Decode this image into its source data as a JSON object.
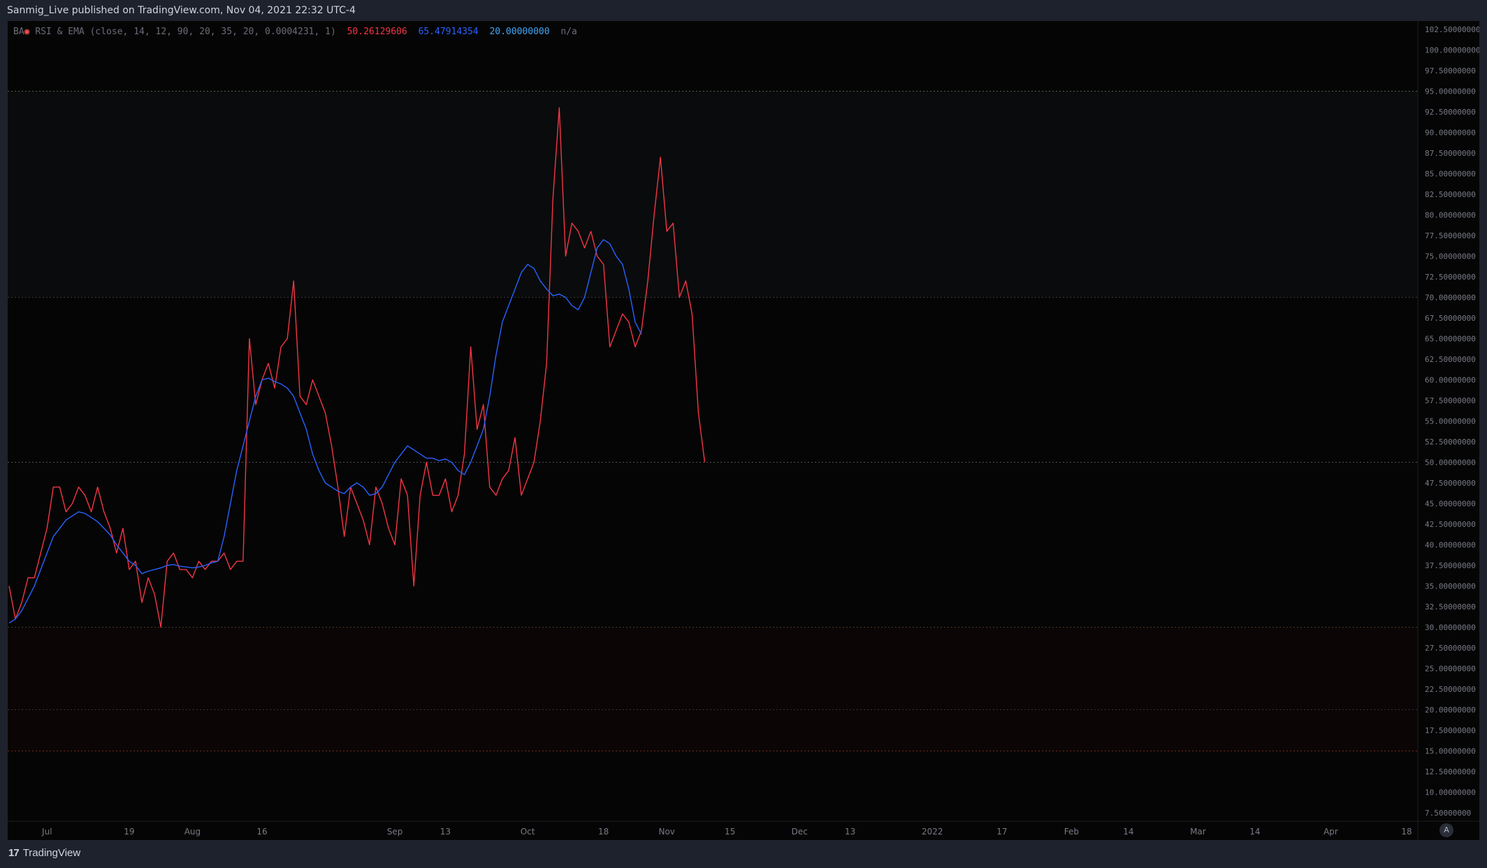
{
  "header": {
    "publish_text": "Sanmig_Live published on TradingView.com, Nov 04, 2021 22:32 UTC-4"
  },
  "legend": {
    "prefix": "BA",
    "badge_icon": "devil-face-icon",
    "study": "RSI & EMA (close, 14, 12, 90, 20, 35, 20, 0.0004231, 1)",
    "value_rsi": "50.26129606",
    "value_ema": "65.47914354",
    "value_level": "20.00000000",
    "value_na": "n/a"
  },
  "footer": {
    "brand": "TradingView",
    "auto_label": "A"
  },
  "colors": {
    "background": "#050505",
    "rsi": "#f23645",
    "ema": "#2962ff",
    "grid": "#1a1a1a",
    "axis_text": "#787b86"
  },
  "chart_data": {
    "type": "line",
    "ylim": [
      7.5,
      102.5
    ],
    "y_ticks": [
      "102.50000000",
      "100.00000000",
      "97.50000000",
      "95.00000000",
      "92.50000000",
      "90.00000000",
      "87.50000000",
      "85.00000000",
      "82.50000000",
      "80.00000000",
      "77.50000000",
      "75.00000000",
      "72.50000000",
      "70.00000000",
      "67.50000000",
      "65.00000000",
      "62.50000000",
      "60.00000000",
      "57.50000000",
      "55.00000000",
      "52.50000000",
      "50.00000000",
      "47.50000000",
      "45.00000000",
      "42.50000000",
      "40.00000000",
      "37.50000000",
      "35.00000000",
      "32.50000000",
      "30.00000000",
      "27.50000000",
      "25.00000000",
      "22.50000000",
      "20.00000000",
      "17.50000000",
      "15.00000000",
      "12.50000000",
      "10.00000000",
      "7.50000000"
    ],
    "x_ticks": [
      {
        "label": "Jul",
        "day": 6
      },
      {
        "label": "19",
        "day": 19
      },
      {
        "label": "Aug",
        "day": 29
      },
      {
        "label": "16",
        "day": 40
      },
      {
        "label": "Sep",
        "day": 61
      },
      {
        "label": "13",
        "day": 69
      },
      {
        "label": "Oct",
        "day": 82
      },
      {
        "label": "18",
        "day": 94
      },
      {
        "label": "Nov",
        "day": 104
      },
      {
        "label": "15",
        "day": 114
      },
      {
        "label": "Dec",
        "day": 125
      },
      {
        "label": "13",
        "day": 133
      },
      {
        "label": "2022",
        "day": 146
      },
      {
        "label": "17",
        "day": 157
      },
      {
        "label": "Feb",
        "day": 168
      },
      {
        "label": "14",
        "day": 177
      },
      {
        "label": "Mar",
        "day": 188
      },
      {
        "label": "14",
        "day": 197
      },
      {
        "label": "Apr",
        "day": 209
      },
      {
        "label": "18",
        "day": 221
      }
    ],
    "levels": [
      {
        "value": 95,
        "color": "#4a6a4a"
      },
      {
        "value": 70,
        "color": "#3a3a3a"
      },
      {
        "value": 50,
        "color": "#555555"
      },
      {
        "value": 30,
        "color": "#4a3a2a"
      },
      {
        "value": 20,
        "color": "#2a3a4a"
      },
      {
        "value": 15,
        "color": "#7a2a1a"
      }
    ],
    "x": [
      0,
      1,
      2,
      3,
      4,
      5,
      6,
      7,
      8,
      9,
      10,
      11,
      12,
      13,
      14,
      15,
      16,
      17,
      18,
      19,
      20,
      21,
      22,
      23,
      24,
      25,
      26,
      27,
      28,
      29,
      30,
      31,
      32,
      33,
      34,
      35,
      36,
      37,
      38,
      39,
      40,
      41,
      42,
      43,
      44,
      45,
      46,
      47,
      48,
      49,
      50,
      51,
      52,
      53,
      54,
      55,
      56,
      57,
      58,
      59,
      60,
      61,
      62,
      63,
      64,
      65,
      66,
      67,
      68,
      69,
      70,
      71,
      72,
      73,
      74,
      75,
      76,
      77,
      78,
      79,
      80,
      81,
      82,
      83,
      84,
      85,
      86,
      87,
      88,
      89,
      90,
      91,
      92,
      93,
      94,
      95,
      96,
      97,
      98,
      99,
      100,
      101,
      102,
      103,
      104,
      105,
      106
    ],
    "series": [
      {
        "values": [
          35,
          31,
          33,
          36,
          36,
          39,
          42,
          47,
          47,
          44,
          45,
          47,
          46,
          44,
          47,
          44,
          42,
          39,
          42,
          37,
          38,
          33,
          36,
          34,
          30,
          38,
          39,
          37,
          37,
          36,
          38,
          37,
          38,
          38,
          39,
          37,
          38,
          38,
          65,
          57,
          60,
          62,
          59,
          64,
          65,
          72,
          58,
          57,
          60,
          58,
          56,
          52,
          47,
          41,
          47,
          45,
          43,
          40,
          47,
          45,
          42,
          40,
          48,
          46,
          35,
          46,
          50,
          46,
          46,
          48,
          44,
          46,
          51,
          64,
          54,
          57,
          47,
          46,
          48,
          49,
          53,
          46,
          48,
          50,
          55,
          62,
          82,
          93,
          75,
          79,
          78,
          76,
          78,
          75,
          74,
          64,
          66,
          68,
          67,
          64,
          66,
          72,
          80,
          87,
          78,
          79,
          70,
          72,
          68,
          56,
          50
        ],
        "color": "#f23645"
      },
      {
        "values": [
          30.5,
          31,
          32,
          33.5,
          35,
          37,
          39,
          41,
          42,
          43,
          43.5,
          44,
          43.8,
          43.3,
          42.8,
          42,
          41.2,
          40,
          39,
          38,
          37.5,
          36.5,
          36.8,
          37,
          37.2,
          37.5,
          37.6,
          37.4,
          37.3,
          37.2,
          37.3,
          37.5,
          37.8,
          38,
          41,
          45,
          49,
          52,
          55,
          58,
          60,
          60.2,
          59.8,
          59.5,
          59,
          58,
          56,
          54,
          51,
          49,
          47.5,
          47,
          46.5,
          46.2,
          47,
          47.5,
          47,
          46,
          46.2,
          47,
          48.5,
          50,
          51,
          52,
          51.5,
          51,
          50.5,
          50.5,
          50.2,
          50.4,
          50,
          49,
          48.5,
          50,
          52,
          54,
          58,
          63,
          67,
          69,
          71,
          73,
          74,
          73.5,
          72,
          71,
          70.2,
          70.4,
          70,
          69,
          68.5,
          70,
          73,
          76,
          77,
          76.5,
          75,
          74,
          71,
          67,
          65.5
        ],
        "color": "#2962ff"
      }
    ]
  }
}
